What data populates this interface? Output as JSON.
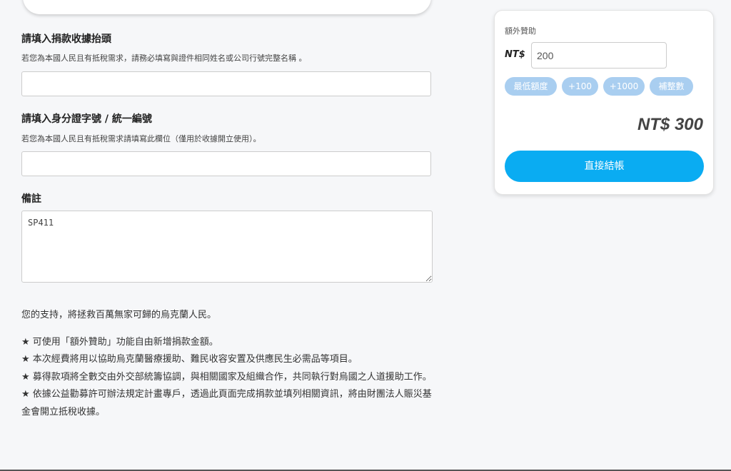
{
  "form": {
    "receipt_title": {
      "label": "請填入捐款收據抬頭",
      "hint": "若您為本國人民且有抵稅需求，請務必填寫與證件相同姓名或公司行號完整名稱 。",
      "value": ""
    },
    "id_number": {
      "label": "請填入身分證字號 / 統一編號",
      "hint": "若您為本國人民且有抵稅需求請填寫此欄位（僅用於收據開立使用）。",
      "value": ""
    },
    "remarks": {
      "label": "備註",
      "value": "SP411"
    }
  },
  "support_text": "您的支持，將拯救百萬無家可歸的烏克蘭人民。",
  "bullets": [
    "★ 可使用「額外贊助」功能自由新增捐款金額。",
    "★ 本次經費將用以協助烏克蘭醫療援助、難民收容安置及供應民生必需品等項目。",
    "★ 募得款項將全數交由外交部統籌協調，與相關國家及組織合作，共同執行對烏國之人道援助工作。",
    "★ 依據公益勸募許可辦法規定計畫專戶，透過此頁面完成捐款並填列相關資訊，將由財團法人賑災基金會開立抵稅收據。"
  ],
  "sidebar": {
    "label": "額外贊助",
    "currency": "NT$",
    "amount_value": "200",
    "chips": [
      "最低額度",
      "+100",
      "+1000",
      "補整數"
    ],
    "total": "NT$ 300",
    "checkout_label": "直接結帳"
  },
  "colors": {
    "accent": "#0aacf2",
    "chip": "#a9cef0",
    "background": "#f6f7f9"
  }
}
